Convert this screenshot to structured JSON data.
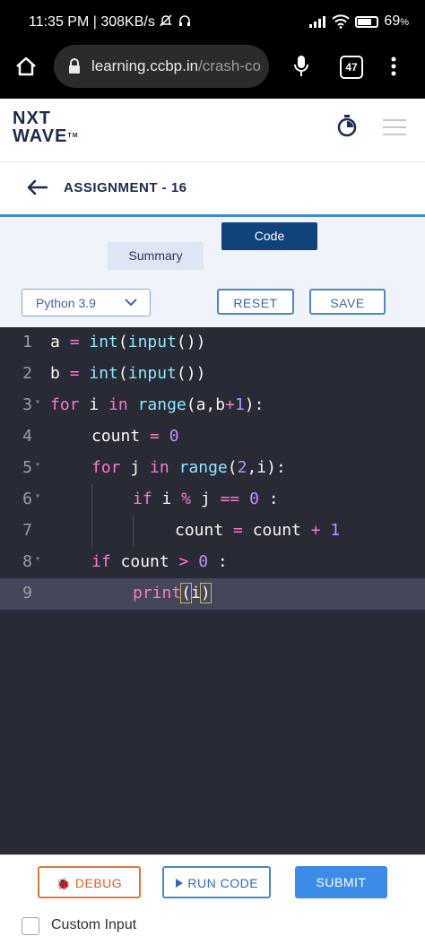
{
  "status": {
    "time": "11:35 PM",
    "speed": "308KB/s",
    "battery": "69",
    "battery_unit": "%"
  },
  "browser": {
    "url_host": "learning.ccbp.in",
    "url_path": "/crash-co",
    "tab_count": "47"
  },
  "header": {
    "logo_line1": "NXT",
    "logo_line2": "WAVE",
    "logo_tm": "TM"
  },
  "page": {
    "title": "ASSIGNMENT - 16"
  },
  "tabs": [
    {
      "label": "Summary"
    },
    {
      "label": "Code"
    }
  ],
  "toolbar": {
    "language": "Python 3.9",
    "reset_label": "RESET",
    "save_label": "SAVE"
  },
  "editor": {
    "line_numbers": [
      "1",
      "2",
      "3",
      "4",
      "5",
      "6",
      "7",
      "8",
      "9"
    ]
  },
  "bottom": {
    "debug_label": "DEBUG",
    "run_label": "RUN CODE",
    "submit_label": "SUBMIT",
    "custom_input_label": "Custom Input"
  },
  "colors": {
    "editor_bg": "#282a36",
    "active_line": "#44475a",
    "brand_navy": "#12427c",
    "accent_blue": "#3c8ce7",
    "debug_orange": "#e0783c"
  }
}
